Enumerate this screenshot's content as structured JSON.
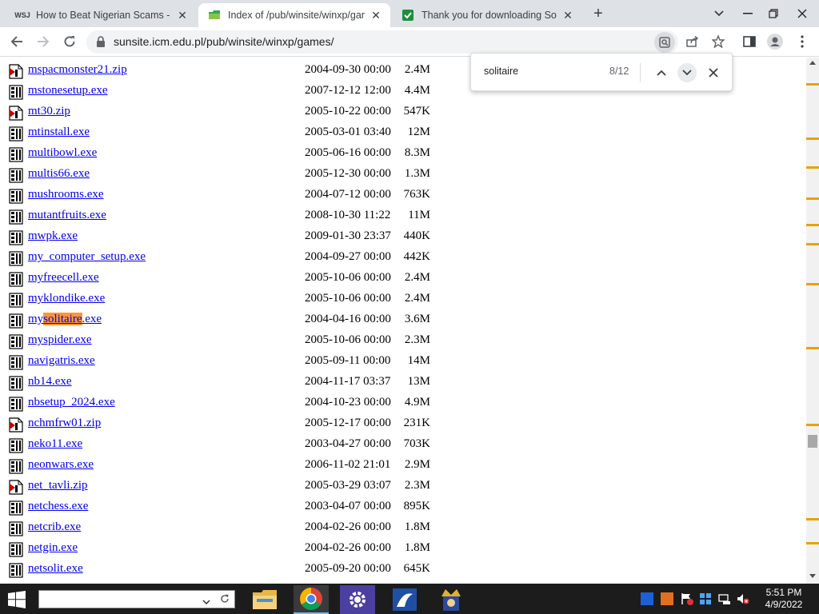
{
  "browser": {
    "tabs": [
      {
        "title": "How to Beat Nigerian Scams - W",
        "favicon": "wsj-icon",
        "favicon_text": "WSJ"
      },
      {
        "title": "Index of /pub/winsite/winxp/gam",
        "favicon": "folder-icon"
      },
      {
        "title": "Thank you for downloading Solit",
        "favicon": "download-page-icon"
      }
    ],
    "url": "sunsite.icm.edu.pl/pub/winsite/winxp/games/"
  },
  "find": {
    "query": "solitaire",
    "count": "8/12"
  },
  "files": [
    {
      "name": "mspacmonster21.zip",
      "date": "2004-09-30 00:00",
      "size": "2.4M",
      "type": "zip"
    },
    {
      "name": "mstonesetup.exe",
      "date": "2007-12-12 12:00",
      "size": "4.4M",
      "type": "exe"
    },
    {
      "name": "mt30.zip",
      "date": "2005-10-22 00:00",
      "size": "547K",
      "type": "zip"
    },
    {
      "name": "mtinstall.exe",
      "date": "2005-03-01 03:40",
      "size": "12M",
      "type": "exe"
    },
    {
      "name": "multibowl.exe",
      "date": "2005-06-16 00:00",
      "size": "8.3M",
      "type": "exe"
    },
    {
      "name": "multis66.exe",
      "date": "2005-12-30 00:00",
      "size": "1.3M",
      "type": "exe"
    },
    {
      "name": "mushrooms.exe",
      "date": "2004-07-12 00:00",
      "size": "763K",
      "type": "exe"
    },
    {
      "name": "mutantfruits.exe",
      "date": "2008-10-30 11:22",
      "size": "11M",
      "type": "exe"
    },
    {
      "name": "mwpk.exe",
      "date": "2009-01-30 23:37",
      "size": "440K",
      "type": "exe"
    },
    {
      "name": "my_computer_setup.exe",
      "date": "2004-09-27 00:00",
      "size": "442K",
      "type": "exe"
    },
    {
      "name": "myfreecell.exe",
      "date": "2005-10-06 00:00",
      "size": "2.4M",
      "type": "exe"
    },
    {
      "name": "myklondike.exe",
      "date": "2005-10-06 00:00",
      "size": "2.4M",
      "type": "exe"
    },
    {
      "name": "mysolitaire.exe",
      "date": "2004-04-16 00:00",
      "size": "3.6M",
      "type": "exe",
      "name_pre": "my",
      "name_match": "solitaire",
      "name_post": ".exe"
    },
    {
      "name": "myspider.exe",
      "date": "2005-10-06 00:00",
      "size": "2.3M",
      "type": "exe"
    },
    {
      "name": "navigatris.exe",
      "date": "2005-09-11 00:00",
      "size": "14M",
      "type": "exe"
    },
    {
      "name": "nb14.exe",
      "date": "2004-11-17 03:37",
      "size": "13M",
      "type": "exe"
    },
    {
      "name": "nbsetup_2024.exe",
      "date": "2004-10-23 00:00",
      "size": "4.9M",
      "type": "exe"
    },
    {
      "name": "nchmfrw01.zip",
      "date": "2005-12-17 00:00",
      "size": "231K",
      "type": "zip"
    },
    {
      "name": "neko11.exe",
      "date": "2003-04-27 00:00",
      "size": "703K",
      "type": "exe"
    },
    {
      "name": "neonwars.exe",
      "date": "2006-11-02 21:01",
      "size": "2.9M",
      "type": "exe"
    },
    {
      "name": "net_tavli.zip",
      "date": "2005-03-29 03:07",
      "size": "2.3M",
      "type": "zip"
    },
    {
      "name": "netchess.exe",
      "date": "2003-04-07 00:00",
      "size": "895K",
      "type": "exe"
    },
    {
      "name": "netcrib.exe",
      "date": "2004-02-26 00:00",
      "size": "1.8M",
      "type": "exe"
    },
    {
      "name": "netgin.exe",
      "date": "2004-02-26 00:00",
      "size": "1.8M",
      "type": "exe"
    },
    {
      "name": "netsolit.exe",
      "date": "2005-09-20 00:00",
      "size": "645K",
      "type": "exe"
    }
  ],
  "taskbar": {
    "apps": [
      "file-explorer-icon",
      "chrome-icon",
      "settings-icon",
      "game-app-icon",
      "solitaire-king-icon"
    ],
    "clock_time": "5:51 PM",
    "clock_date": "4/9/2022"
  },
  "colors": {
    "link": "#0000ee",
    "find_highlight": "#ff9632",
    "scroll_match_tick": "#e4a400",
    "tab_strip": "#dee1e6"
  }
}
